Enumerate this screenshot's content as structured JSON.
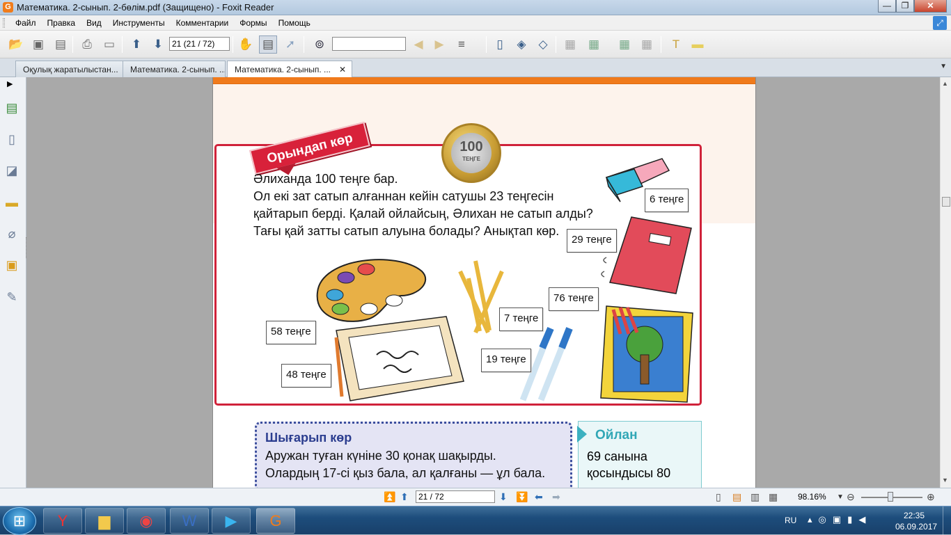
{
  "window": {
    "title": "Математика. 2-сынып. 2-бөлім.pdf (Защищено) - Foxit Reader",
    "app_icon": "foxit-icon",
    "buttons": {
      "minimize": "—",
      "maximize": "❐",
      "close": "✕"
    }
  },
  "menu": {
    "items": [
      "Файл",
      "Правка",
      "Вид",
      "Инструменты",
      "Комментарии",
      "Формы",
      "Помощь"
    ]
  },
  "toolbar": {
    "page_field": "21 (21 / 72)",
    "find_field": ""
  },
  "tabs": [
    {
      "label": "Оқулық жаратылыстан...",
      "active": false
    },
    {
      "label": "Математика. 2-сынып. ...",
      "active": false
    },
    {
      "label": "Математика. 2-сынып. ...",
      "active": true,
      "close": "✕"
    }
  ],
  "document": {
    "banner": "Орындап көр",
    "coin": {
      "value": "100",
      "caption": "ТЕҢГЕ"
    },
    "task_lines": [
      "Әлиханда 100 теңге бар.",
      "Ол екі зат сатып алғаннан кейін сатушы 23 теңгесін",
      "қайтарып берді. Қалай ойлайсың, Әлихан не сатып алды?",
      "Тағы қай затты сатып алуына болады? Анықтап көр."
    ],
    "prices": {
      "eraser": "6 теңге",
      "notebook": "29 теңге",
      "coloring_book": "76 теңге",
      "pencils": "7 теңге",
      "pens": "19 теңге",
      "palette": "58 теңге",
      "sketchbook": "48 теңге"
    },
    "exercise": {
      "heading": "Шығарып көр",
      "line1": "Аружан туған күніне 30 қонақ  шақырды.",
      "line2": "Олардың 17-сі қыз бала, ал қалғаны — ұл бала."
    },
    "think": {
      "heading": "Ойлан",
      "line1": "69 санына",
      "line2": "қосындысы 80"
    }
  },
  "statusbar": {
    "page_field": "21 / 72",
    "zoom": "98.16%"
  },
  "taskbar": {
    "apps": [
      "yandex-browser-icon",
      "explorer-icon",
      "chrome-icon",
      "word-icon",
      "media-player-icon",
      "foxit-icon"
    ],
    "active_app": "foxit-icon",
    "language": "RU",
    "time": "22:35",
    "date": "06.09.2017"
  }
}
